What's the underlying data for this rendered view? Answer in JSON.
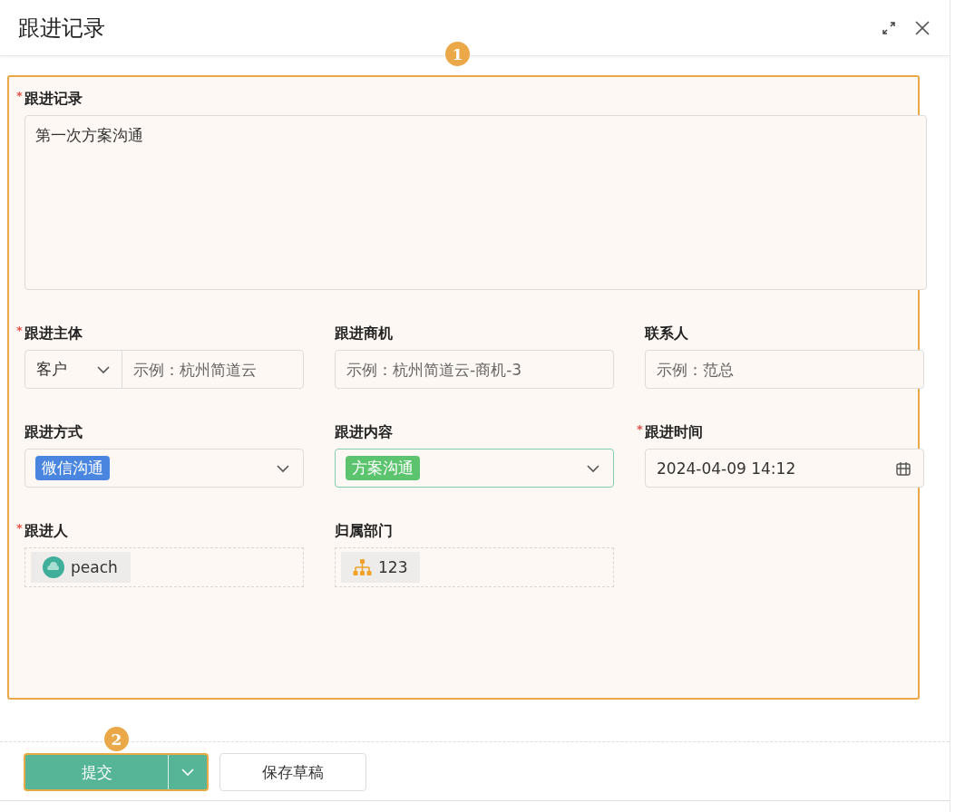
{
  "window": {
    "title": "跟进记录"
  },
  "form": {
    "annotation": "1",
    "highlighted": true,
    "fields": [
      {
        "kind": "textarea",
        "required_mark": "*",
        "label": "跟进记录",
        "value": "第一次方案沟通"
      },
      {
        "kind": "subject",
        "required_mark": "*",
        "label": "跟进主体",
        "option": "客户",
        "placeholder": "示例：杭州简道云"
      },
      {
        "kind": "input",
        "label": "跟进商机",
        "placeholder": "示例：杭州简道云-商机-3"
      },
      {
        "kind": "input",
        "label": "联系人",
        "placeholder": "示例：范总"
      },
      {
        "kind": "tag-select",
        "label": "跟进方式",
        "tag": "微信沟通",
        "color": "#4a86e0",
        "focused": false
      },
      {
        "kind": "tag-select",
        "label": "跟进内容",
        "tag": "方案沟通",
        "color": "#5cc46f",
        "focused": true
      },
      {
        "kind": "datetime",
        "required_mark": "*",
        "label": "跟进时间",
        "value": "2024-04-09 14:12"
      },
      {
        "kind": "member",
        "required_mark": "*",
        "label": "跟进人",
        "value": "peach"
      },
      {
        "kind": "department",
        "label": "归属部门",
        "value": "123"
      }
    ]
  },
  "footer": {
    "annotation": "2",
    "submit": {
      "label": "提交",
      "highlighted": true
    },
    "save_draft": "保存草稿"
  }
}
